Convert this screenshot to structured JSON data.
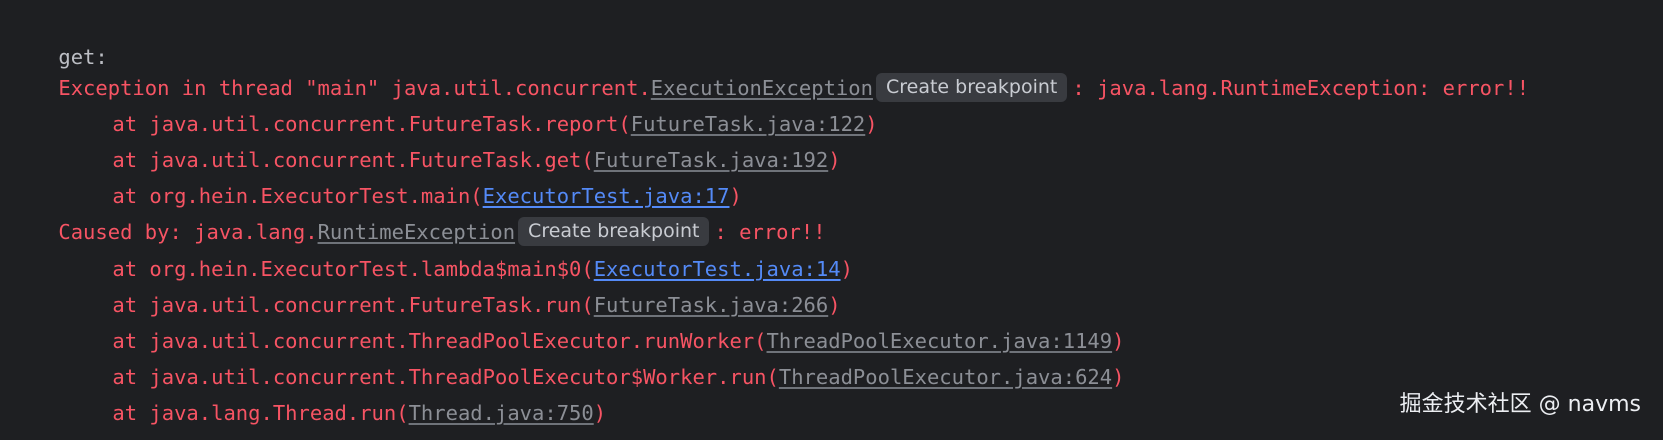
{
  "console": {
    "line0": {
      "text": "get:"
    },
    "line1": {
      "prefix": "Exception in thread \"main\" java.util.concurrent.",
      "link": "ExecutionException",
      "chip": "Create breakpoint",
      "suffix": ": java.lang.RuntimeException: error!!"
    },
    "line2": {
      "prefix": "at java.util.concurrent.FutureTask.report(",
      "link": "FutureTask.java:122",
      "suffix": ")"
    },
    "line3": {
      "prefix": "at java.util.concurrent.FutureTask.get(",
      "link": "FutureTask.java:192",
      "suffix": ")"
    },
    "line4": {
      "prefix": "at org.hein.ExecutorTest.main(",
      "link": "ExecutorTest.java:17",
      "suffix": ")"
    },
    "line5": {
      "prefix": "Caused by: java.lang.",
      "link": "RuntimeException",
      "chip": "Create breakpoint",
      "suffix": ": error!!"
    },
    "line6": {
      "prefix": "at org.hein.ExecutorTest.lambda$main$0(",
      "link": "ExecutorTest.java:14",
      "suffix": ")"
    },
    "line7": {
      "prefix": "at java.util.concurrent.FutureTask.run(",
      "link": "FutureTask.java:266",
      "suffix": ")"
    },
    "line8": {
      "prefix": "at java.util.concurrent.ThreadPoolExecutor.runWorker(",
      "link": "ThreadPoolExecutor.java:1149",
      "suffix": ")"
    },
    "line9": {
      "prefix": "at java.util.concurrent.ThreadPoolExecutor$Worker.run(",
      "link": "ThreadPoolExecutor.java:624",
      "suffix": ")"
    },
    "line10": {
      "prefix": "at java.lang.Thread.run(",
      "link": "Thread.java:750",
      "suffix": ")"
    }
  },
  "watermark": "掘金技术社区 @ navms",
  "colors": {
    "background": "#1e1f22",
    "plain_text": "#bcbec4",
    "error_text": "#f75464",
    "library_link": "#8c8f96",
    "user_link": "#548af7",
    "chip_background": "#393b40",
    "chip_text": "#c9ccd2"
  }
}
